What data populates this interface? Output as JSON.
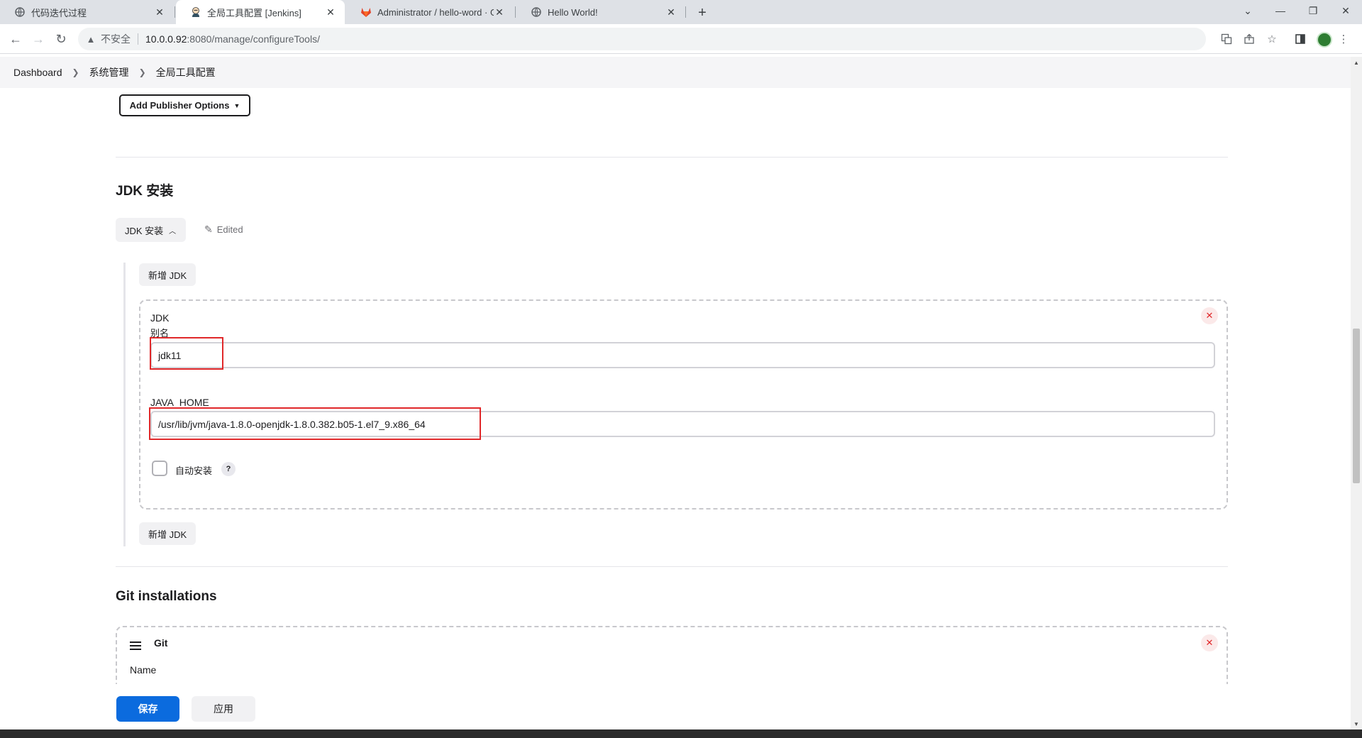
{
  "browser": {
    "tabs": [
      {
        "title": "代码迭代过程",
        "icon": "globe-icon",
        "active": false
      },
      {
        "title": "全局工具配置 [Jenkins]",
        "icon": "jenkins-icon",
        "active": true
      },
      {
        "title": "Administrator / hello-word · G",
        "icon": "gitlab-icon",
        "active": false
      },
      {
        "title": "Hello World!",
        "icon": "globe-icon",
        "active": false
      }
    ],
    "address": {
      "insecure_label": "不安全",
      "host": "10.0.0.92",
      "path": ":8080/manage/configureTools/"
    }
  },
  "breadcrumb": {
    "items": [
      "Dashboard",
      "系统管理",
      "全局工具配置"
    ]
  },
  "publisher": {
    "add_label": "Add Publisher Options"
  },
  "jdk_section": {
    "title": "JDK 安装",
    "toggle_label": "JDK 安装",
    "edited_label": "Edited",
    "add_label": "新增 JDK",
    "add_label_bottom": "新增 JDK",
    "card": {
      "heading": "JDK",
      "alias_label": "别名",
      "alias_value": "jdk11",
      "java_home_label": "JAVA_HOME",
      "java_home_value": "/usr/lib/jvm/java-1.8.0-openjdk-1.8.0.382.b05-1.el7_9.x86_64",
      "auto_install_label": "自动安装",
      "help_label": "?"
    }
  },
  "git_section": {
    "title": "Git installations",
    "card": {
      "heading": "Git",
      "name_label": "Name"
    }
  },
  "actions": {
    "save_label": "保存",
    "apply_label": "应用"
  },
  "colors": {
    "primary": "#0b6bde",
    "highlight": "#e0282a",
    "close": "#e0282a"
  }
}
